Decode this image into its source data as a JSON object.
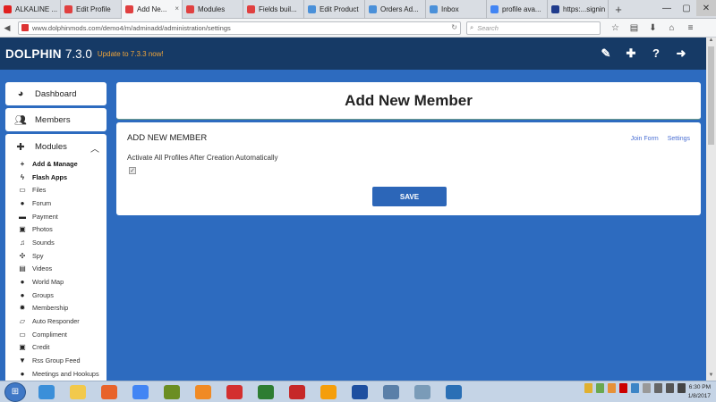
{
  "browser": {
    "tabs": [
      {
        "label": "ALKALINE ...",
        "color": "#e02020"
      },
      {
        "label": "Edit Profile",
        "color": "#e04040"
      },
      {
        "label": "Add Ne...",
        "color": "#e04040",
        "active": true
      },
      {
        "label": "Modules",
        "color": "#e04040"
      },
      {
        "label": "Fields buil...",
        "color": "#e04040"
      },
      {
        "label": "Edit Product",
        "color": "#4a90d9"
      },
      {
        "label": "Orders Ad...",
        "color": "#4a90d9"
      },
      {
        "label": "Inbox",
        "color": "#4a90d9"
      },
      {
        "label": "profile ava...",
        "color": "#4285f4"
      },
      {
        "label": "https:...signin",
        "color": "#1f3b8c"
      }
    ],
    "new_tab": "+",
    "url": "www.dolphinmods.com/demo4/m/adminadd/administration/settings",
    "search_placeholder": "Search"
  },
  "app": {
    "brand": "DOLPHIN",
    "version": "7.3.0",
    "update_notice": "Update to 7.3.3 now!"
  },
  "sidebar": {
    "dashboard": "Dashboard",
    "members": "Members",
    "modules": "Modules",
    "items": [
      {
        "label": "Add & Manage",
        "icon": "+",
        "bold": true
      },
      {
        "label": "Flash Apps",
        "icon": "ϟ",
        "bold": true
      },
      {
        "label": "Files",
        "icon": "▭"
      },
      {
        "label": "Forum",
        "icon": "●"
      },
      {
        "label": "Payment",
        "icon": "▬"
      },
      {
        "label": "Photos",
        "icon": "▣"
      },
      {
        "label": "Sounds",
        "icon": "♫"
      },
      {
        "label": "Spy",
        "icon": "✣"
      },
      {
        "label": "Videos",
        "icon": "▤"
      },
      {
        "label": "World Map",
        "icon": "●"
      },
      {
        "label": "Groups",
        "icon": "●"
      },
      {
        "label": "Membership",
        "icon": "✹"
      },
      {
        "label": "Auto Responder",
        "icon": "▱"
      },
      {
        "label": "Compliment",
        "icon": "▭"
      },
      {
        "label": "Credit",
        "icon": "▣"
      },
      {
        "label": "Rss Group Feed",
        "icon": "▼"
      },
      {
        "label": "Meetings and Hookups",
        "icon": "●"
      }
    ]
  },
  "main": {
    "page_title": "Add New Member",
    "form_title": "ADD NEW MEMBER",
    "link_join_form": "Join Form",
    "link_settings": "Settings",
    "option_label": "Activate All Profiles After Creation Automatically",
    "option_checked": true,
    "save_label": "SAVE"
  },
  "taskbar": {
    "time": "6:30 PM",
    "date": "1/8/2017",
    "apps": [
      "#3b8fd9",
      "#f2c94c",
      "#e8632b",
      "#4285f4",
      "#6b8e23",
      "#f08a24",
      "#d32f2f",
      "#2e7d32",
      "#c62828",
      "#f59e0b",
      "#1e4fa0",
      "#5a7fa8",
      "#7a9bb8",
      "#2a6fb5"
    ]
  },
  "colors": {
    "page_bg": "#2d6bbf",
    "header_bg": "#163a66",
    "accent": "#2c66b8",
    "update_text": "#f0a53a",
    "link": "#4a6fd3"
  }
}
